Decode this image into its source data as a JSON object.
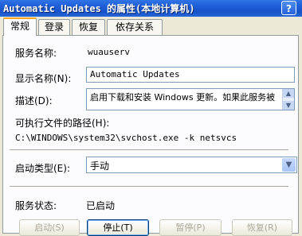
{
  "window": {
    "title": "Automatic Updates 的属性(本地计算机)",
    "help_label": "?"
  },
  "tabs": [
    {
      "label": "常规",
      "active": true
    },
    {
      "label": "登录",
      "active": false
    },
    {
      "label": "恢复",
      "active": false
    },
    {
      "label": "依存关系",
      "active": false
    }
  ],
  "general": {
    "service_name_label": "服务名称:",
    "service_name_value": "wuauserv",
    "display_name_label": "显示名称(N):",
    "display_name_value": "Automatic Updates",
    "description_label": "描述(D):",
    "description_value": "启用下载和安装 Windows 更新。如果此服务被",
    "exe_path_label": "可执行文件的路径(H):",
    "exe_path_value": "C:\\WINDOWS\\system32\\svchost.exe -k netsvcs",
    "startup_type_label": "启动类型(E):",
    "startup_type_value": "手动",
    "status_label": "服务状态:",
    "status_value": "已启动"
  },
  "buttons": {
    "start": "启动(S)",
    "stop": "停止(T)",
    "pause": "暂停(P)",
    "resume": "恢复(R)"
  },
  "colors": {
    "titlebar": "#1e5fd8",
    "dialog_bg": "#ece9d8",
    "tab_highlight": "#f5a623"
  }
}
